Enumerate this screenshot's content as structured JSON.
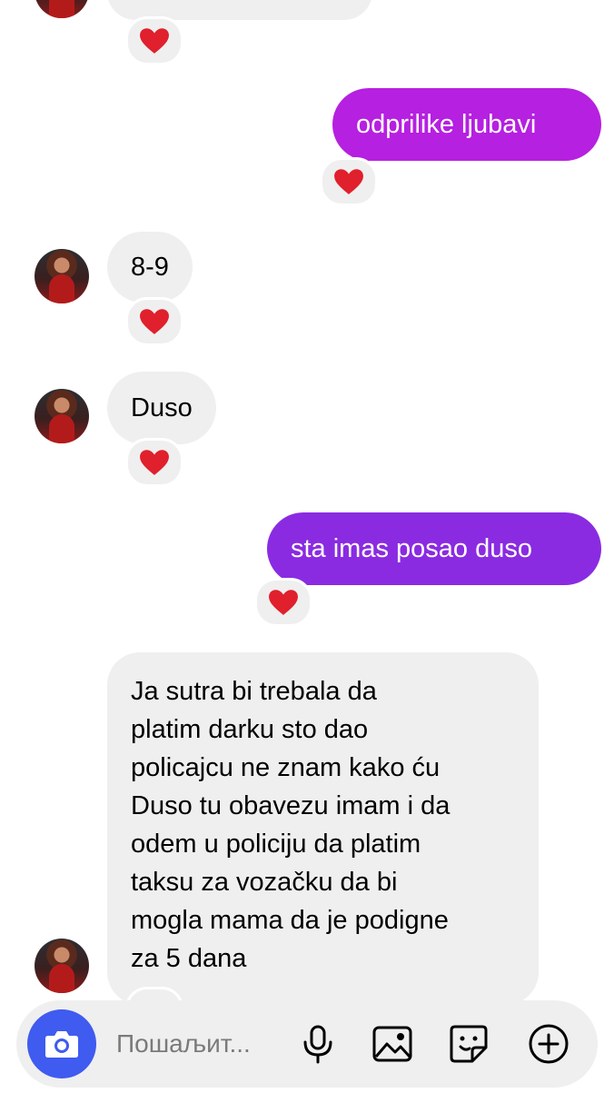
{
  "messages": [
    {
      "id": "m1",
      "side": "in",
      "text": "8-9"
    },
    {
      "id": "m2",
      "side": "in",
      "text": "Duso"
    },
    {
      "id": "o1",
      "side": "out",
      "text": "odprilike ljubavi"
    },
    {
      "id": "o2",
      "side": "out",
      "text": "sta imas posao duso"
    },
    {
      "id": "m3",
      "side": "in",
      "lines": [
        "Ja sutra bi trebala da",
        "platim darku sto dao",
        "policajcu ne znam kako ću",
        "Duso tu obavezu imam i da",
        "odem u policiju da platim",
        "taksu za vozačku da bi",
        "mogla mama da je podigne",
        "za 5 dana"
      ]
    }
  ],
  "reaction": "❤️",
  "composer": {
    "placeholder": "Пошаљит..."
  },
  "colors": {
    "incoming_bubble": "#efefef",
    "outgoing_magenta": "#b620e0",
    "outgoing_purple": "#8a2be2",
    "camera_button": "#3f5bf0",
    "heart": "#e0202c"
  },
  "icons": [
    "camera-icon",
    "microphone-icon",
    "gallery-icon",
    "sticker-icon",
    "plus-icon",
    "heart-icon"
  ]
}
